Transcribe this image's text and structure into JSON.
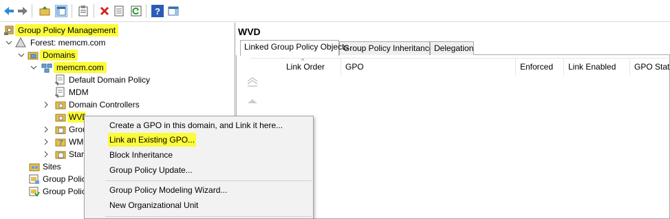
{
  "toolbar": {
    "icons": [
      "back-arrow-icon",
      "forward-arrow-icon",
      "up-folder-icon",
      "show-hide-tree-icon",
      "clipboard-icon",
      "delete-icon",
      "properties-icon",
      "refresh-icon",
      "help-icon",
      "action-pane-icon"
    ]
  },
  "tree": {
    "root": "Group Policy Management",
    "forest": "Forest: memcm.com",
    "domains": "Domains",
    "domain": "memcm.com",
    "items": [
      "Default Domain Policy",
      "MDM",
      "Domain Controllers",
      "WVD",
      "Grou",
      "WM",
      "Star"
    ],
    "sites": "Sites",
    "gp_modeling": "Group Polic",
    "gp_results": "Group Polic"
  },
  "right": {
    "title": "WVD",
    "tabs": [
      "Linked Group Policy Objects",
      "Group Policy Inheritance",
      "Delegation"
    ],
    "columns": [
      "Link Order",
      "GPO",
      "Enforced",
      "Link Enabled",
      "GPO Status"
    ]
  },
  "menu": {
    "items": [
      "Create a GPO in this domain, and Link it here...",
      "Link an Existing GPO...",
      "Block Inheritance",
      "Group Policy Update...",
      "Group Policy Modeling Wizard...",
      "New Organizational Unit"
    ]
  },
  "colors": {
    "highlight": "#fbfb3a",
    "border": "#a0a0a0",
    "menu_bg": "#f2f2f2"
  }
}
